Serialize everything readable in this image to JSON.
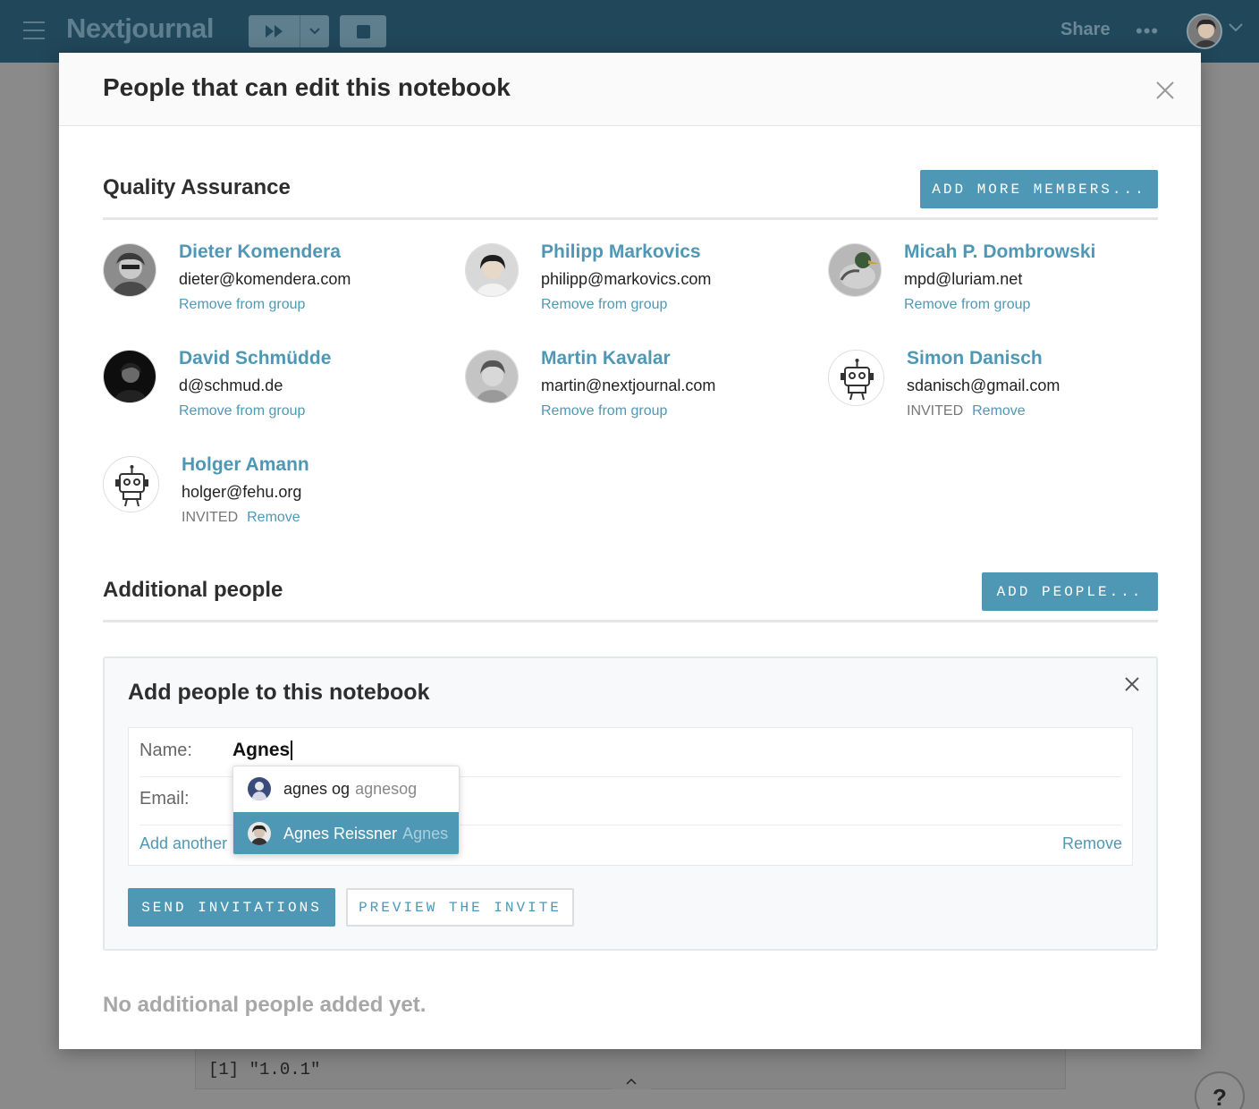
{
  "topbar": {
    "brand": "Nextjournal",
    "share_label": "Share",
    "more_label": "•••"
  },
  "modal": {
    "title": "People that can edit this notebook"
  },
  "group": {
    "title": "Quality Assurance",
    "add_button": "ADD MORE MEMBERS...",
    "members": [
      {
        "name": "Dieter Komendera",
        "email": "dieter@komendera.com",
        "invited": "",
        "action": "Remove from group"
      },
      {
        "name": "Philipp Markovics",
        "email": "philipp@markovics.com",
        "invited": "",
        "action": "Remove from group"
      },
      {
        "name": "Micah P. Dombrowski",
        "email": "mpd@luriam.net",
        "invited": "",
        "action": "Remove from group"
      },
      {
        "name": "David Schmüdde",
        "email": "d@schmud.de",
        "invited": "",
        "action": "Remove from group"
      },
      {
        "name": "Martin Kavalar",
        "email": "martin@nextjournal.com",
        "invited": "",
        "action": "Remove from group"
      },
      {
        "name": "Simon Danisch",
        "email": "sdanisch@gmail.com",
        "invited": "INVITED",
        "action": "Remove"
      },
      {
        "name": "Holger Amann",
        "email": "holger@fehu.org",
        "invited": "INVITED",
        "action": "Remove"
      }
    ]
  },
  "additional": {
    "title": "Additional people",
    "add_button": "ADD PEOPLE...",
    "empty_note": "No additional people added yet."
  },
  "add_panel": {
    "title": "Add people to this notebook",
    "name_label": "Name:",
    "name_value": "Agnes",
    "email_label": "Email:",
    "add_another": "Add another",
    "remove": "Remove",
    "send_button": "SEND INVITATIONS",
    "preview_button": "PREVIEW THE INVITE",
    "suggestions": [
      {
        "name": "agnes og",
        "handle": "agnesog",
        "selected": false
      },
      {
        "name": "Agnes Reissner",
        "handle": "Agnes",
        "selected": true
      }
    ]
  },
  "background": {
    "code_output": "[1] \"1.0.1\"",
    "help_label": "?"
  },
  "colors": {
    "accent": "#4f98b5",
    "topbar": "#21475a",
    "overlay": "#8a8a8a"
  }
}
